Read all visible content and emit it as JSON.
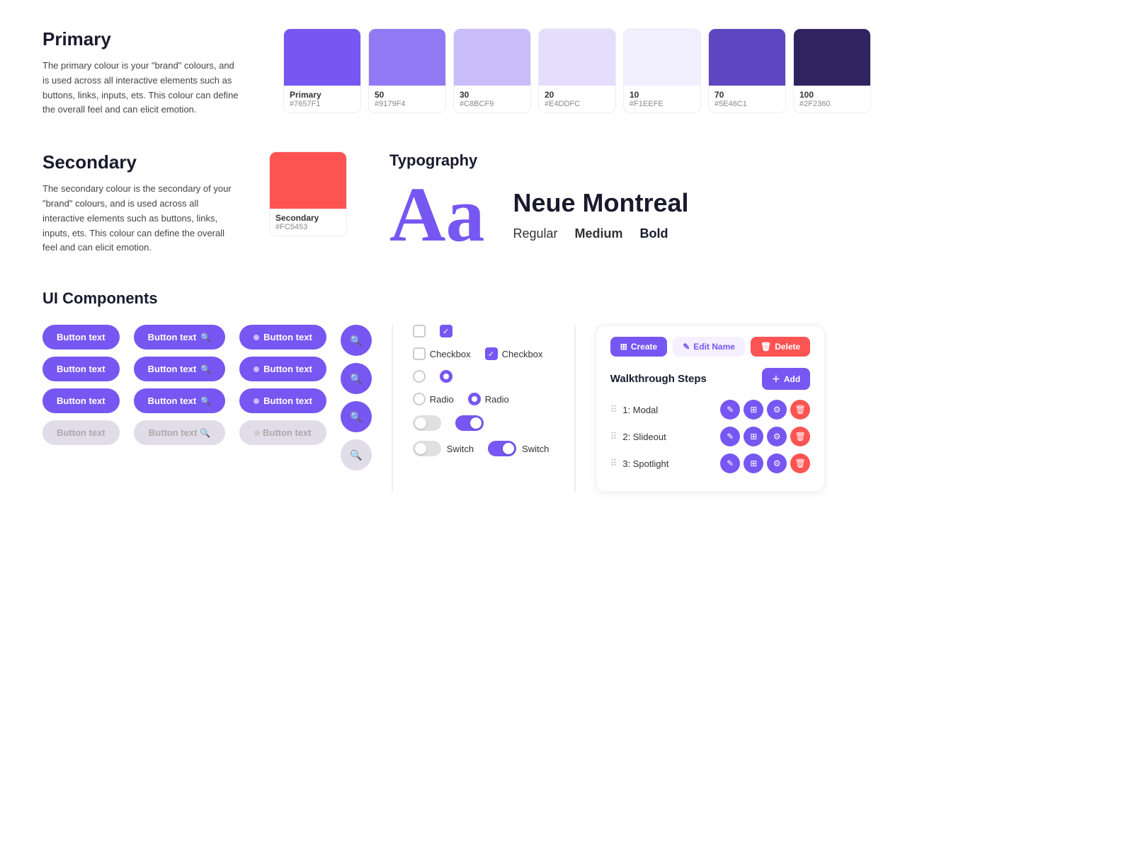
{
  "primary": {
    "title": "Primary",
    "description": "The primary colour is your \"brand\" colours, and is used across all interactive elements such as buttons, links, inputs, ets. This colour can define the overall feel and can elicit emotion.",
    "swatches": [
      {
        "label": "Primary",
        "hex": "#7657F1",
        "display": "Primary",
        "hexDisplay": "#7657F1"
      },
      {
        "label": "50",
        "hex": "#9179F4",
        "display": "50",
        "hexDisplay": "#9179F4"
      },
      {
        "label": "30",
        "hex": "#C8BCF9",
        "display": "30",
        "hexDisplay": "#C8BCF9"
      },
      {
        "label": "20",
        "hex": "#E4DDFC",
        "display": "20",
        "hexDisplay": "#E4DDFC"
      },
      {
        "label": "10",
        "hex": "#F1EEFE",
        "display": "10",
        "hexDisplay": "#F1EEFE"
      },
      {
        "label": "70",
        "hex": "#5E46C1",
        "display": "70",
        "hexDisplay": "#5E46C1"
      },
      {
        "label": "100",
        "hex": "#2F2360",
        "display": "100",
        "hexDisplay": "#2F2360"
      }
    ]
  },
  "secondary": {
    "title": "Secondary",
    "description": "The secondary colour is the secondary of your \"brand\" colours, and is used across all interactive elements such as buttons, links, inputs, ets. This colour can define the overall feel and can elicit emotion.",
    "swatch": {
      "label": "Secondary",
      "hex": "#FC5453",
      "display": "Secondary",
      "hexDisplay": "#FC5453"
    }
  },
  "typography": {
    "title": "Typography",
    "display_text": "Aa",
    "font_name": "Neue Montreal",
    "weights": {
      "regular": "Regular",
      "medium": "Medium",
      "bold": "Bold"
    }
  },
  "ui_components": {
    "title": "UI Components",
    "buttons": {
      "col1": [
        {
          "label": "Button text",
          "type": "primary"
        },
        {
          "label": "Button text",
          "type": "primary"
        },
        {
          "label": "Button text",
          "type": "primary"
        },
        {
          "label": "Button text",
          "type": "disabled"
        }
      ],
      "col2": [
        {
          "label": "Button text",
          "type": "primary-icon"
        },
        {
          "label": "Button text",
          "type": "primary-icon"
        },
        {
          "label": "Button text",
          "type": "primary-icon"
        },
        {
          "label": "Button text",
          "type": "disabled-icon"
        }
      ],
      "col3": [
        {
          "label": "Button text",
          "type": "primary-badge"
        },
        {
          "label": "Button text",
          "type": "primary-badge"
        },
        {
          "label": "Button text",
          "type": "primary-badge"
        },
        {
          "label": "Button text",
          "type": "disabled-badge"
        }
      ],
      "col4": [
        {
          "type": "icon-circle"
        },
        {
          "type": "icon-circle"
        },
        {
          "type": "icon-circle"
        },
        {
          "type": "icon-circle-disabled"
        }
      ]
    },
    "checkboxes": {
      "unchecked_label": "Checkbox",
      "checked_label": "Checkbox"
    },
    "radios": {
      "unchecked_label": "Radio",
      "checked_label": "Radio"
    },
    "switches": {
      "off_label": "Switch",
      "on_label": "Switch"
    },
    "walkthrough": {
      "create_label": "Create",
      "edit_label": "Edit Name",
      "delete_label": "Delete",
      "steps_title": "Walkthrough Steps",
      "add_label": "Add",
      "steps": [
        {
          "id": "1",
          "label": "1: Modal"
        },
        {
          "id": "2",
          "label": "2: Slideout"
        },
        {
          "id": "3",
          "label": "3: Spotlight"
        }
      ]
    }
  }
}
